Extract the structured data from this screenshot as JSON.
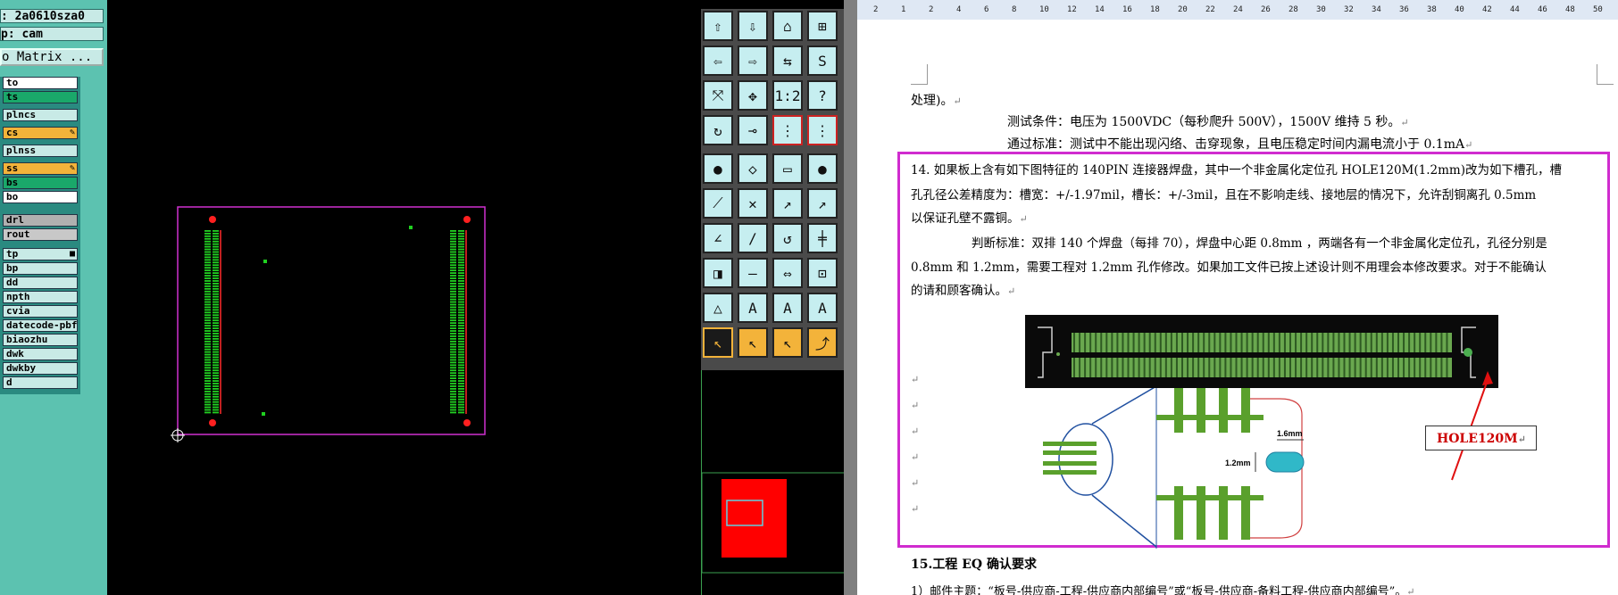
{
  "cam": {
    "job_field": ": 2a0610sza0",
    "step_field": "p: cam",
    "matrix_button": "o Matrix ...",
    "layers": [
      {
        "name": "to",
        "color": "#ffffff"
      },
      {
        "name": "ts",
        "color": "#1aa86a"
      },
      {
        "name": "plncs",
        "color": "#c8eae6"
      },
      {
        "name": "cs",
        "color": "#f3b33a",
        "mark": "✎"
      },
      {
        "name": "plnss",
        "color": "#c8eae6"
      },
      {
        "name": "ss",
        "color": "#f3b33a",
        "mark": "✎"
      },
      {
        "name": "bs",
        "color": "#1aa86a"
      },
      {
        "name": "bo",
        "color": "#ffffff"
      },
      {
        "name": "drl",
        "color": "#b0b0b0"
      },
      {
        "name": "rout",
        "color": "#c8c8c8"
      },
      {
        "name": "tp",
        "color": "#c8eae6",
        "mark": "■"
      },
      {
        "name": "bp",
        "color": "#c8eae6"
      },
      {
        "name": "dd",
        "color": "#c8eae6"
      },
      {
        "name": "npth",
        "color": "#c8eae6"
      },
      {
        "name": "cvia",
        "color": "#c8eae6"
      },
      {
        "name": "datecode-pbf",
        "color": "#c8eae6"
      },
      {
        "name": "biaozhu",
        "color": "#c8eae6"
      },
      {
        "name": "dwk",
        "color": "#c8eae6"
      },
      {
        "name": "dwkby",
        "color": "#c8eae6"
      },
      {
        "name": "d",
        "color": "#c8eae6"
      }
    ]
  },
  "tools": [
    "⇧",
    "⇩",
    "⌂",
    "⊞",
    "⇦",
    "⇨",
    "⇆",
    "S",
    "⤧",
    "✥",
    "1:2",
    "?",
    "↻",
    "⊸",
    "⋮",
    "⋮",
    "●",
    "◇",
    "▭",
    "●",
    "⟋",
    "✕",
    "↗",
    "↗",
    "∠",
    "∕",
    "↺",
    "╪",
    "◨",
    "—",
    "⇔",
    "⊡",
    "△",
    "A",
    "A",
    "A",
    "↖",
    "↖",
    "↖",
    "⤴"
  ],
  "doc": {
    "ruler_ticks": [
      "2",
      "1",
      "2",
      "4",
      "6",
      "8",
      "10",
      "12",
      "14",
      "16",
      "18",
      "20",
      "22",
      "24",
      "26",
      "28",
      "30",
      "32",
      "34",
      "36",
      "38",
      "40",
      "42",
      "44",
      "46",
      "48",
      "50"
    ],
    "line_1": "处理)。",
    "line_2": "测试条件：电压为 1500VDC（每秒爬升 500V），1500V 维持 5 秒。",
    "line_3": "通过标准：测试中不能出现闪络、击穿现象，且电压稳定时间内漏电流小于 0.1mA",
    "item14_l1": "14. 如果板上含有如下图特征的 140PIN 连接器焊盘，其中一个非金属化定位孔 HOLE120M(1.2mm)改为如下槽孔，槽",
    "item14_l2": "孔孔径公差精度为：槽宽：+/-1.97mil，槽长：+/-3mil，且在不影响走线、接地层的情况下，允许刮铜离孔 0.5mm",
    "item14_l3": "以保证孔壁不露铜。",
    "judge_l1": "判断标准：双排 140 个焊盘（每排 70），焊盘中心距 0.8mm ，两端各有一个非金属化定位孔，孔径分别是",
    "judge_l2": "0.8mm 和 1.2mm，需要工程对 1.2mm 孔作修改。如果加工文件已按上述设计则不用理会本修改要求。对于不能确认",
    "judge_l3": "的请和顾客确认。",
    "dim_16": "1.6mm",
    "dim_12": "1.2mm",
    "hole_label": "HOLE120M",
    "section_15": "15.工程 EQ 确认要求",
    "line_15_1": "1）邮件主题：“板号-供应商-工程-供应商内部编号”或“板号-供应商-备料工程-供应商内部编号”。"
  }
}
